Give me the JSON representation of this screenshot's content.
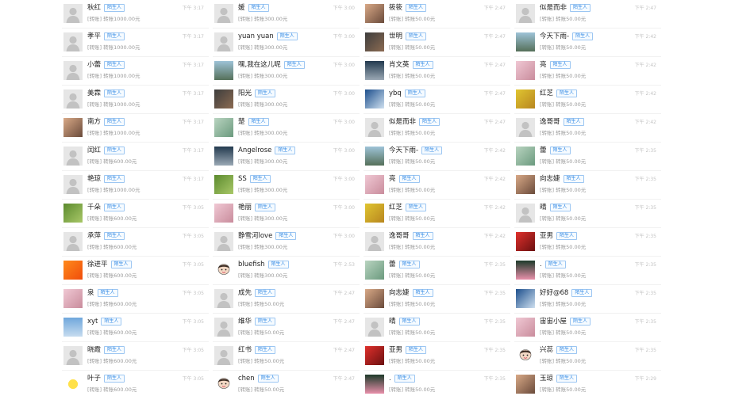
{
  "stranger_tag": "陌生人",
  "columns": [
    [
      {
        "name": "秋红",
        "msg": "[转账] 转账1000.00元",
        "time": "下午 3:17",
        "avatar": "default"
      },
      {
        "name": "孝平",
        "msg": "[转账] 转账1000.00元",
        "time": "下午 3:17",
        "avatar": "default"
      },
      {
        "name": "小蕾",
        "msg": "[转账] 转账1000.00元",
        "time": "下午 3:17",
        "avatar": "default"
      },
      {
        "name": "美霖",
        "msg": "[转账] 转账1000.00元",
        "time": "下午 3:17",
        "avatar": "default"
      },
      {
        "name": "南方",
        "msg": "[转账] 转账1000.00元",
        "time": "下午 3:17",
        "avatar": "face"
      },
      {
        "name": "闰红",
        "msg": "[转账] 转账600.00元",
        "time": "下午 3:17",
        "avatar": "default"
      },
      {
        "name": "艳琼",
        "msg": "[转账] 转账1000.00元",
        "time": "下午 3:17",
        "avatar": "default"
      },
      {
        "name": "千朵",
        "msg": "[转账] 转账600.00元",
        "time": "下午 3:05",
        "avatar": "green"
      },
      {
        "name": "承萍",
        "msg": "[转账] 转账600.00元",
        "time": "下午 3:05",
        "avatar": "default"
      },
      {
        "name": "徐进平",
        "msg": "[转账] 转账600.00元",
        "time": "下午 3:05",
        "avatar": "orange"
      },
      {
        "name": "泉",
        "msg": "[转账] 转账600.00元",
        "time": "下午 3:05",
        "avatar": "pink"
      },
      {
        "name": "xyt",
        "msg": "[转账] 转账600.00元",
        "time": "下午 3:05",
        "avatar": "sky"
      },
      {
        "name": "晓霞",
        "msg": "[转账] 转账600.00元",
        "time": "下午 3:05",
        "avatar": "default"
      },
      {
        "name": "叶子",
        "msg": "[转账] 转账600.00元",
        "time": "下午 3:05",
        "avatar": "sun"
      }
    ],
    [
      {
        "name": "媛",
        "msg": "[转账] 转账300.00元",
        "time": "下午 3:00",
        "avatar": "default"
      },
      {
        "name": "yuan yuan",
        "msg": "[转账] 转账300.00元",
        "time": "下午 3:00",
        "avatar": "default"
      },
      {
        "name": "嘿,我在这儿呢",
        "msg": "[转账] 转账300.00元",
        "time": "下午 3:00",
        "avatar": "tree"
      },
      {
        "name": "阳光",
        "msg": "[转账] 转账300.00元",
        "time": "下午 3:00",
        "avatar": "dark"
      },
      {
        "name": "楚",
        "msg": "[转账] 转账300.00元",
        "time": "下午 3:00",
        "avatar": "flower"
      },
      {
        "name": "Angelrose",
        "msg": "[转账] 转账300.00元",
        "time": "下午 3:00",
        "avatar": "night"
      },
      {
        "name": "SS",
        "msg": "[转账] 转账300.00元",
        "time": "下午 3:00",
        "avatar": "green"
      },
      {
        "name": "艳丽",
        "msg": "[转账] 转账300.00元",
        "time": "下午 3:00",
        "avatar": "pink"
      },
      {
        "name": "静雪河love",
        "msg": "[转账] 转账300.00元",
        "time": "下午 3:00",
        "avatar": "default"
      },
      {
        "name": "bluefish",
        "msg": "[转账] 转账300.00元",
        "time": "下午 2:53",
        "avatar": "cartoon"
      },
      {
        "name": "成先",
        "msg": "[转账] 转账50.00元",
        "time": "下午 2:47",
        "avatar": "default"
      },
      {
        "name": "维华",
        "msg": "[转账] 转账50.00元",
        "time": "下午 2:47",
        "avatar": "default"
      },
      {
        "name": "红书",
        "msg": "[转账] 转账50.00元",
        "time": "下午 2:47",
        "avatar": "default"
      },
      {
        "name": "chen",
        "msg": "[转账] 转账50.00元",
        "time": "下午 2:47",
        "avatar": "cartoon"
      }
    ],
    [
      {
        "name": "筱筱",
        "msg": "[转账] 转账50.00元",
        "time": "下午 2:47",
        "avatar": "face"
      },
      {
        "name": "世明",
        "msg": "[转账] 转账50.00元",
        "time": "下午 2:47",
        "avatar": "dark"
      },
      {
        "name": "肖文英",
        "msg": "[转账] 转账50.00元",
        "time": "下午 2:47",
        "avatar": "night"
      },
      {
        "name": "ybq",
        "msg": "[转账] 转账50.00元",
        "time": "下午 2:47",
        "avatar": "blue"
      },
      {
        "name": "似是而非",
        "msg": "[转账] 转账50.00元",
        "time": "下午 2:47",
        "avatar": "default"
      },
      {
        "name": "今天下雨-",
        "msg": "[转账] 转账50.00元",
        "time": "下午 2:42",
        "avatar": "tree"
      },
      {
        "name": "亮",
        "msg": "[转账] 转账50.00元",
        "time": "下午 2:42",
        "avatar": "pink"
      },
      {
        "name": "红芝",
        "msg": "[转账] 转账50.00元",
        "time": "下午 2:42",
        "avatar": "yellow"
      },
      {
        "name": "逸哥哥",
        "msg": "[转账] 转账50.00元",
        "time": "下午 2:42",
        "avatar": "default"
      },
      {
        "name": "蕾",
        "msg": "[转账] 转账50.00元",
        "time": "下午 2:35",
        "avatar": "flower"
      },
      {
        "name": "向志婕",
        "msg": "[转账] 转账50.00元",
        "time": "下午 2:35",
        "avatar": "face"
      },
      {
        "name": "晴",
        "msg": "[转账] 转账50.00元",
        "time": "下午 2:35",
        "avatar": "default"
      },
      {
        "name": "亚男",
        "msg": "[转账] 转账50.00元",
        "time": "下午 2:35",
        "avatar": "red"
      },
      {
        "name": ".",
        "msg": "[转账] 转账50.00元",
        "time": "下午 2:35",
        "avatar": "lotus"
      }
    ],
    [
      {
        "name": "似是而非",
        "msg": "[转账] 转账50.00元",
        "time": "下午 2:47",
        "avatar": "default"
      },
      {
        "name": "今天下雨-",
        "msg": "[转账] 转账50.00元",
        "time": "下午 2:42",
        "avatar": "tree"
      },
      {
        "name": "亮",
        "msg": "[转账] 转账50.00元",
        "time": "下午 2:42",
        "avatar": "pink"
      },
      {
        "name": "红芝",
        "msg": "[转账] 转账50.00元",
        "time": "下午 2:42",
        "avatar": "yellow"
      },
      {
        "name": "逸哥哥",
        "msg": "[转账] 转账50.00元",
        "time": "下午 2:42",
        "avatar": "default"
      },
      {
        "name": "蕾",
        "msg": "[转账] 转账50.00元",
        "time": "下午 2:35",
        "avatar": "flower"
      },
      {
        "name": "向志婕",
        "msg": "[转账] 转账50.00元",
        "time": "下午 2:35",
        "avatar": "face"
      },
      {
        "name": "晴",
        "msg": "[转账] 转账50.00元",
        "time": "下午 2:35",
        "avatar": "default"
      },
      {
        "name": "亚男",
        "msg": "[转账] 转账50.00元",
        "time": "下午 2:35",
        "avatar": "red"
      },
      {
        "name": ".",
        "msg": "[转账] 转账50.00元",
        "time": "下午 2:35",
        "avatar": "lotus"
      },
      {
        "name": "好好@68",
        "msg": "[转账] 转账50.00元",
        "time": "下午 2:35",
        "avatar": "blue"
      },
      {
        "name": "宙宙小屋",
        "msg": "[转账] 转账50.00元",
        "time": "下午 2:35",
        "avatar": "pink"
      },
      {
        "name": "兴蕊",
        "msg": "[转账] 转账50.00元",
        "time": "下午 2:35",
        "avatar": "cartoon"
      },
      {
        "name": "玉琼",
        "msg": "[转账] 转账50.00元",
        "time": "下午 2:29",
        "avatar": "face"
      }
    ]
  ]
}
